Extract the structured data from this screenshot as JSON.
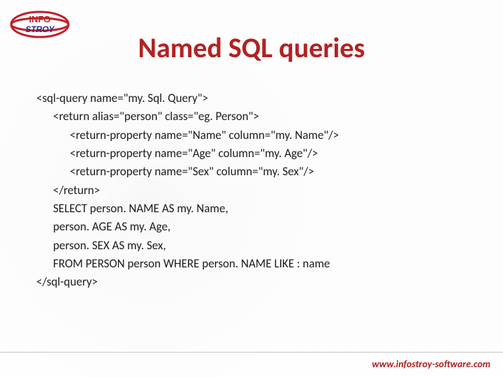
{
  "logo": {
    "top": "INFO",
    "bottom": "STROY"
  },
  "title": "Named SQL queries",
  "code": {
    "l0": "<sql-query name=\"my. Sql. Query\">",
    "l1": "<return alias=\"person\" class=\"eg. Person\">",
    "l2": "<return-property name=\"Name\" column=\"my. Name\"/>",
    "l3": "<return-property name=\"Age\" column=\"my. Age\"/>",
    "l4": "<return-property name=\"Sex\" column=\"my. Sex\"/>",
    "l5": "</return>",
    "l6": "SELECT person. NAME AS my. Name,",
    "l7": "person. AGE AS my. Age,",
    "l8": "person. SEX AS my. Sex,",
    "l9": "FROM PERSON person WHERE person. NAME LIKE : name",
    "l10": "</sql-query>"
  },
  "footer_url": "www.infostroy-software.com"
}
